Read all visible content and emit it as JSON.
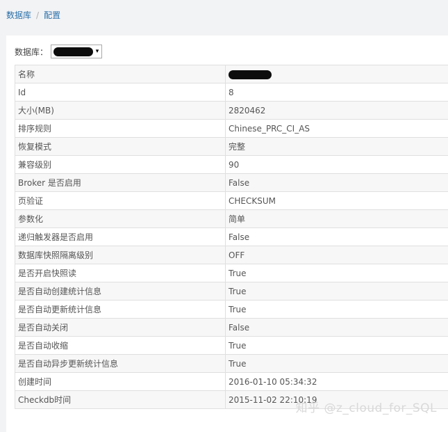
{
  "breadcrumb": {
    "items": [
      "数据库",
      "配置"
    ],
    "separator": "/"
  },
  "selector": {
    "label": "数据库：",
    "value": "redacted",
    "arrow": "▾"
  },
  "properties": [
    {
      "key": "名称",
      "value": "redacted"
    },
    {
      "key": "Id",
      "value": "8"
    },
    {
      "key": "大小(MB)",
      "value": "2820462"
    },
    {
      "key": "排序规则",
      "value": "Chinese_PRC_CI_AS"
    },
    {
      "key": "恢复模式",
      "value": "完整"
    },
    {
      "key": "兼容级别",
      "value": "90"
    },
    {
      "key": "Broker 是否启用",
      "value": "False"
    },
    {
      "key": "页验证",
      "value": "CHECKSUM"
    },
    {
      "key": "参数化",
      "value": "简单"
    },
    {
      "key": "递归触发器是否启用",
      "value": "False"
    },
    {
      "key": "数据库快照隔离级别",
      "value": "OFF"
    },
    {
      "key": "是否开启快照读",
      "value": "True"
    },
    {
      "key": "是否自动创建统计信息",
      "value": "True"
    },
    {
      "key": "是否自动更新统计信息",
      "value": "True"
    },
    {
      "key": "是否自动关闭",
      "value": "False"
    },
    {
      "key": "是否自动收缩",
      "value": "True"
    },
    {
      "key": "是否自动异步更新统计信息",
      "value": "True"
    },
    {
      "key": "创建时间",
      "value": "2016-01-10 05:34:32"
    },
    {
      "key": "Checkdb时间",
      "value": "2015-11-02 22:10:19"
    }
  ],
  "watermark": "知乎 @z_cloud_for_SQL",
  "colors": {
    "link": "#2a6fa8",
    "page_bg": "#f2f3f5",
    "row_alt": "#f7f7f7",
    "border": "#dfdfdf"
  }
}
